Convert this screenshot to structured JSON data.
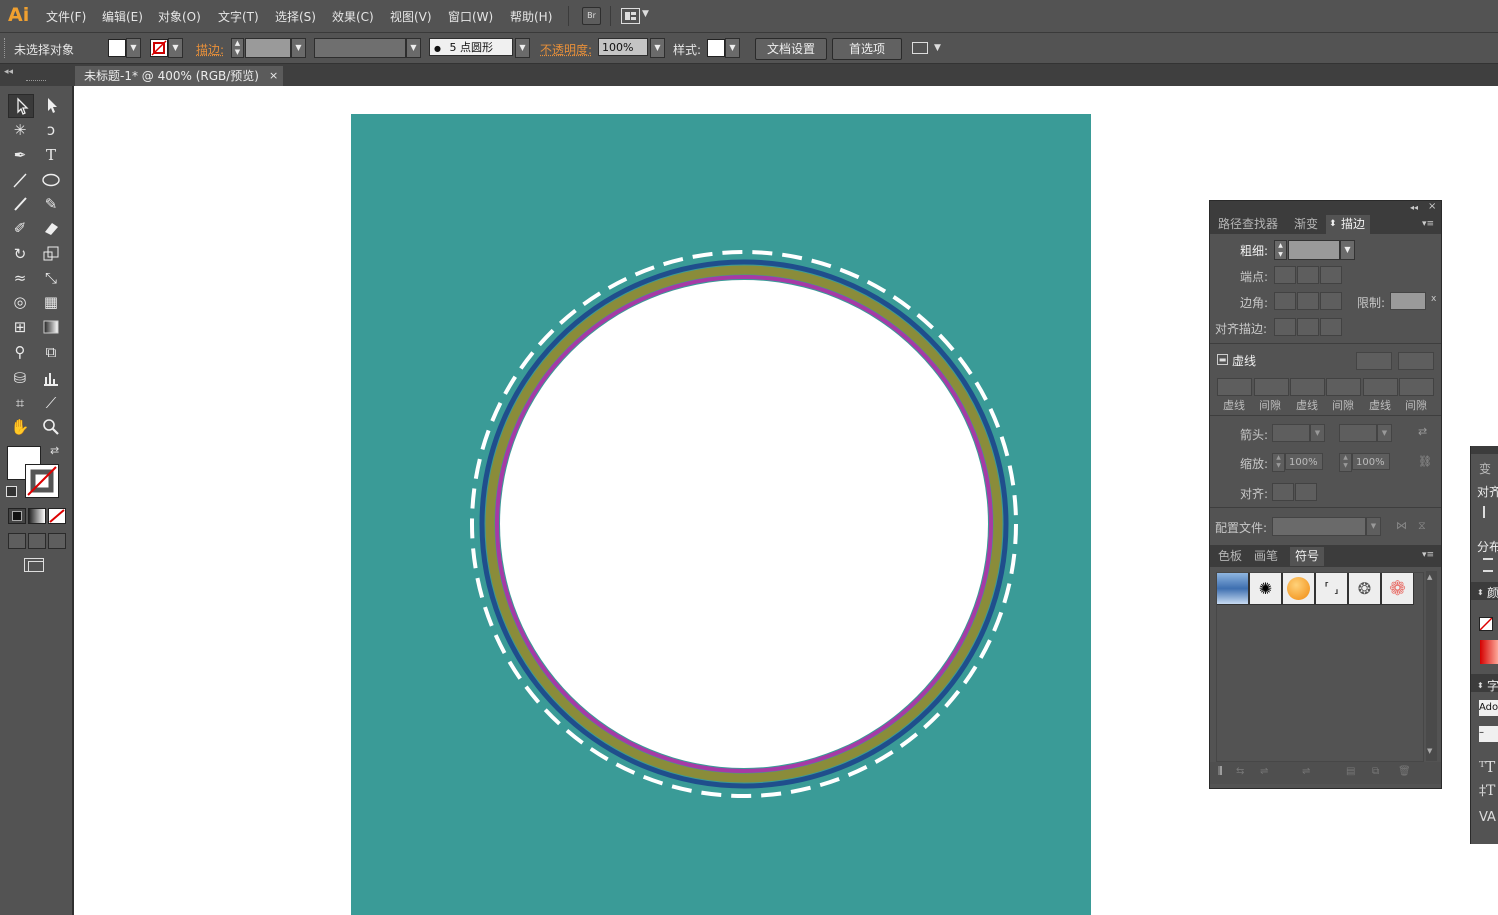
{
  "app": {
    "logo": "Ai",
    "accent": "#f0a030"
  },
  "menu": {
    "items": [
      "文件(F)",
      "编辑(E)",
      "对象(O)",
      "文字(T)",
      "选择(S)",
      "效果(C)",
      "视图(V)",
      "窗口(W)",
      "帮助(H)"
    ],
    "bridge_label": "Br"
  },
  "control_bar": {
    "selection_status": "未选择对象",
    "stroke_label": "描边:",
    "brush_value": "5 点圆形",
    "opacity_label": "不透明度:",
    "opacity_value": "100%",
    "style_label": "样式:",
    "doc_setup_button": "文档设置",
    "preferences_button": "首选项"
  },
  "document": {
    "tab_title": "未标题-1* @ 400% (RGB/预览)",
    "tab_close": "×",
    "artboard_color": "#3a9b97"
  },
  "artwork": {
    "rings": [
      {
        "name": "dashed-ring",
        "color": "#ffffff",
        "style": "dashed"
      },
      {
        "name": "blue-ring",
        "color": "#1f4e8c",
        "style": "solid"
      },
      {
        "name": "olive-ring",
        "color": "#8a8c3a",
        "style": "solid"
      },
      {
        "name": "magenta-ring",
        "color": "#a63aa6",
        "style": "solid"
      }
    ],
    "inner_fill": "#ffffff"
  },
  "stroke_panel": {
    "tabs": [
      "路径查找器",
      "渐变",
      "描边"
    ],
    "active_tab": "描边",
    "weight_label": "粗细:",
    "cap_label": "端点:",
    "corner_label": "边角:",
    "limit_label": "限制:",
    "limit_suffix": "x",
    "align_label": "对齐描边:",
    "dashed_label": "虚线",
    "dash_labels": [
      "虚线",
      "间隙",
      "虚线",
      "间隙",
      "虚线",
      "间隙"
    ],
    "arrow_label": "箭头:",
    "scale_label": "缩放:",
    "scale_values": [
      "100%",
      "100%"
    ],
    "arrow_align_label": "对齐:",
    "profile_label": "配置文件:"
  },
  "swatch_panel": {
    "tabs": [
      "色板",
      "画笔",
      "符号"
    ],
    "active_tab": "符号"
  },
  "right_dock": {
    "labels": [
      "变",
      "对齐",
      "分布",
      "颜",
      "字",
      "Ado"
    ]
  }
}
